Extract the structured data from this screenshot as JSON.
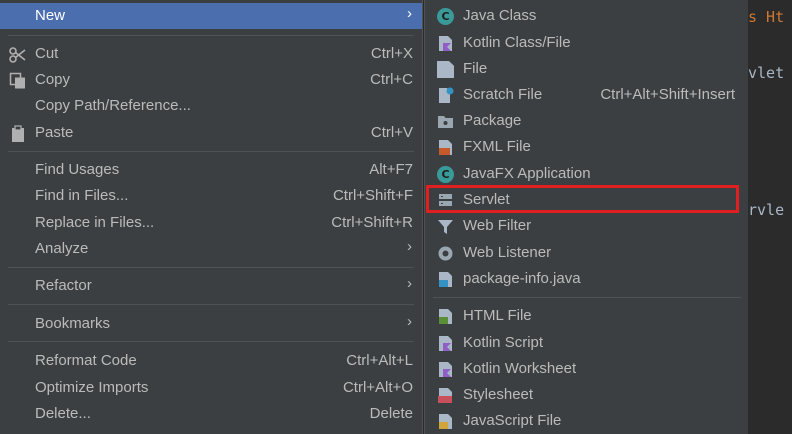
{
  "editor": {
    "line1": "s Ht",
    "line2": "vlet",
    "line3": "rvle"
  },
  "main_menu": {
    "new": {
      "label": "New"
    },
    "cut": {
      "label": "Cut",
      "shortcut": "Ctrl+X"
    },
    "copy": {
      "label": "Copy",
      "shortcut": "Ctrl+C"
    },
    "copy_path": {
      "label": "Copy Path/Reference..."
    },
    "paste": {
      "label": "Paste",
      "shortcut": "Ctrl+V"
    },
    "find_usages": {
      "label": "Find Usages",
      "shortcut": "Alt+F7"
    },
    "find_in_files": {
      "label": "Find in Files...",
      "shortcut": "Ctrl+Shift+F"
    },
    "replace_in_files": {
      "label": "Replace in Files...",
      "shortcut": "Ctrl+Shift+R"
    },
    "analyze": {
      "label": "Analyze"
    },
    "refactor": {
      "label": "Refactor"
    },
    "bookmarks": {
      "label": "Bookmarks"
    },
    "reformat_code": {
      "label": "Reformat Code",
      "shortcut": "Ctrl+Alt+L"
    },
    "optimize_imports": {
      "label": "Optimize Imports",
      "shortcut": "Ctrl+Alt+O"
    },
    "delete": {
      "label": "Delete...",
      "shortcut": "Delete"
    }
  },
  "sub_menu": {
    "java_class": {
      "label": "Java Class"
    },
    "kotlin_class": {
      "label": "Kotlin Class/File"
    },
    "file": {
      "label": "File"
    },
    "scratch_file": {
      "label": "Scratch File",
      "shortcut": "Ctrl+Alt+Shift+Insert"
    },
    "package": {
      "label": "Package"
    },
    "fxml_file": {
      "label": "FXML File"
    },
    "javafx_app": {
      "label": "JavaFX Application"
    },
    "servlet": {
      "label": "Servlet"
    },
    "web_filter": {
      "label": "Web Filter"
    },
    "web_listener": {
      "label": "Web Listener"
    },
    "package_info": {
      "label": "package-info.java"
    },
    "html_file": {
      "label": "HTML File"
    },
    "kotlin_script": {
      "label": "Kotlin Script"
    },
    "kotlin_worksheet": {
      "label": "Kotlin Worksheet"
    },
    "stylesheet": {
      "label": "Stylesheet"
    },
    "javascript_file": {
      "label": "JavaScript File"
    }
  },
  "icons": {
    "java_class_letter": "C",
    "javafx_letter": "C",
    "fxml_tag": "<>",
    "html_tag": "H",
    "css_tag": "CSS",
    "package_info_tag": "J"
  },
  "colors": {
    "menu_bg": "#3c3f41",
    "selection": "#4b6eaf",
    "highlight_box": "#e02020",
    "text": "#bbbbbb"
  }
}
